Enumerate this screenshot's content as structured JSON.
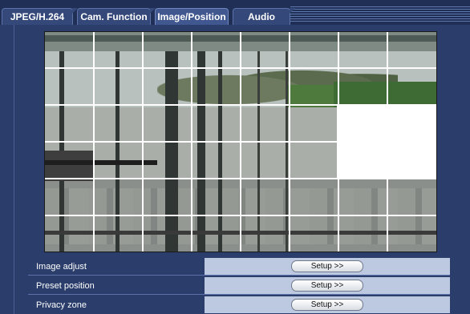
{
  "tabs": [
    {
      "label": "JPEG/H.264",
      "active": false
    },
    {
      "label": "Cam. Function",
      "active": false
    },
    {
      "label": "Image/Position",
      "active": true
    },
    {
      "label": "Audio",
      "active": false
    }
  ],
  "preview": {
    "grid_columns": 8,
    "grid_rows": 6,
    "privacy_zone_color": "#ffffff"
  },
  "settings_rows": [
    {
      "label": "Image adjust",
      "button": "Setup >>"
    },
    {
      "label": "Preset position",
      "button": "Setup >>"
    },
    {
      "label": "Privacy zone",
      "button": "Setup >>"
    }
  ],
  "colors": {
    "background": "#2b3e6b",
    "tab_active": "#40578f",
    "row_cell": "#bcc9e0"
  }
}
